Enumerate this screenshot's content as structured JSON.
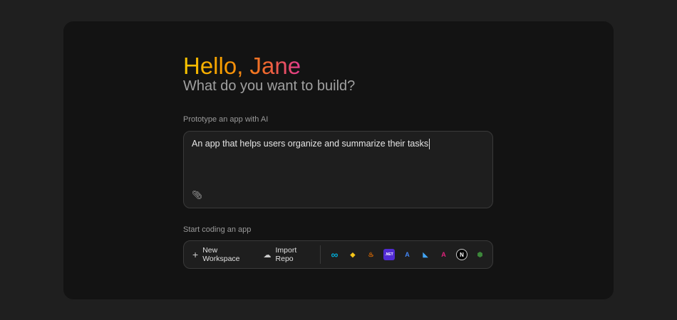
{
  "greeting": "Hello, Jane",
  "subtitle": "What do you want to build?",
  "prototype": {
    "label": "Prototype an app with AI",
    "value": "An app that helps users organize and summarize their tasks"
  },
  "coding": {
    "label": "Start coding an app",
    "new_workspace": "New Workspace",
    "import_repo": "Import Repo"
  },
  "frameworks": [
    {
      "name": "go",
      "glyph": "∞",
      "color": "#00acd7",
      "bg": "transparent"
    },
    {
      "name": "python",
      "glyph": "◆",
      "color": "#f5c518",
      "bg": "transparent"
    },
    {
      "name": "java",
      "glyph": "♨",
      "color": "#e76f00",
      "bg": "transparent"
    },
    {
      "name": "dotnet",
      "glyph": ".NET",
      "color": "#ffffff",
      "bg": "#512bd4"
    },
    {
      "name": "android-studio",
      "glyph": "A",
      "color": "#4285f4",
      "bg": "transparent"
    },
    {
      "name": "flutter",
      "glyph": "◣",
      "color": "#42a5f5",
      "bg": "transparent"
    },
    {
      "name": "angular",
      "glyph": "A",
      "color": "#e0237c",
      "bg": "transparent"
    },
    {
      "name": "nextjs",
      "glyph": "N",
      "color": "#ffffff",
      "bg": "#000000"
    },
    {
      "name": "nodejs",
      "glyph": "⬢",
      "color": "#3c873a",
      "bg": "transparent"
    }
  ]
}
